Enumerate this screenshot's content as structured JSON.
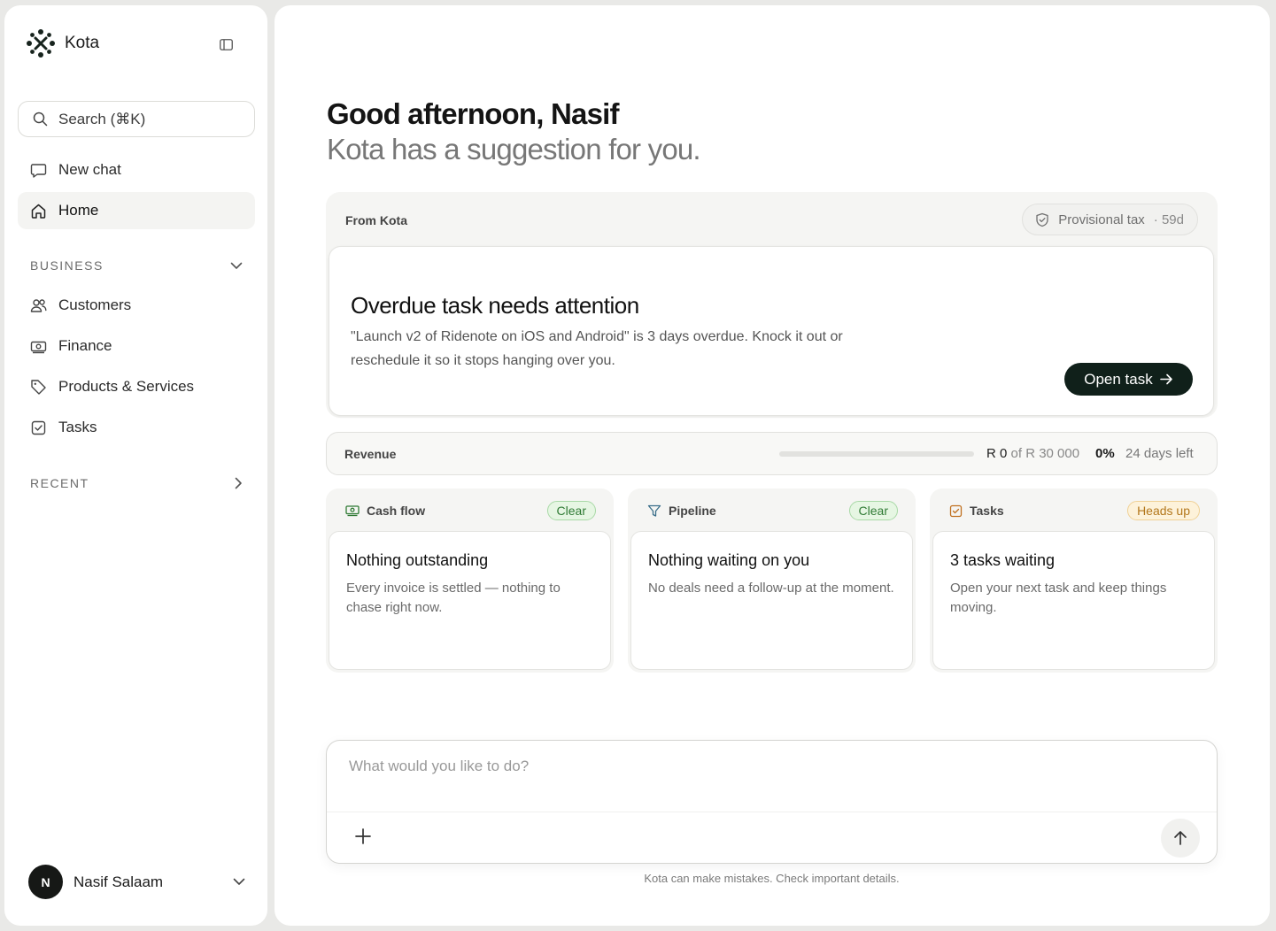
{
  "brand": {
    "name": "Kota",
    "accent": "#10201a"
  },
  "sidebar": {
    "search_label": "Search (⌘K)",
    "new_chat": "New chat",
    "home": "Home",
    "business_heading": "BUSINESS",
    "business_items": [
      {
        "label": "Customers",
        "icon": "users-icon"
      },
      {
        "label": "Finance",
        "icon": "banknote-icon"
      },
      {
        "label": "Products & Services",
        "icon": "tag-icon"
      },
      {
        "label": "Tasks",
        "icon": "checkbox-icon"
      }
    ],
    "recent_heading": "RECENT",
    "user": {
      "initial": "N",
      "name": "Nasif Salaam"
    }
  },
  "main": {
    "greeting": "Good afternoon, Nasif",
    "subtitle": "Kota has a suggestion for you.",
    "suggestion": {
      "from": "From Kota",
      "pill_label": "Provisional tax",
      "pill_days": "· 59d",
      "title": "Overdue task needs attention",
      "body": "\"Launch v2 of Ridenote on iOS and Android\" is 3 days overdue. Knock it out or reschedule it so it stops hanging over you.",
      "button": "Open task"
    },
    "revenue": {
      "label": "Revenue",
      "progress": 0,
      "current": "R 0",
      "of_text": "of R 30 000",
      "percent": "0%",
      "days_left": "24 days left"
    },
    "cards": [
      {
        "heading": "Cash flow",
        "icon": "banknote-icon",
        "badge": "Clear",
        "badge_type": "clear",
        "title": "Nothing outstanding",
        "body": "Every invoice is settled — nothing to chase right now."
      },
      {
        "heading": "Pipeline",
        "icon": "filter-icon",
        "badge": "Clear",
        "badge_type": "clear",
        "title": "Nothing waiting on you",
        "body": "No deals need a follow-up at the moment."
      },
      {
        "heading": "Tasks",
        "icon": "checkbox-icon",
        "badge": "Heads up",
        "badge_type": "warn",
        "title": "3 tasks waiting",
        "body": "Open your next task and keep things moving."
      }
    ],
    "composer": {
      "placeholder": "What would you like to do?"
    },
    "disclaimer": "Kota can make mistakes. Check important details."
  }
}
